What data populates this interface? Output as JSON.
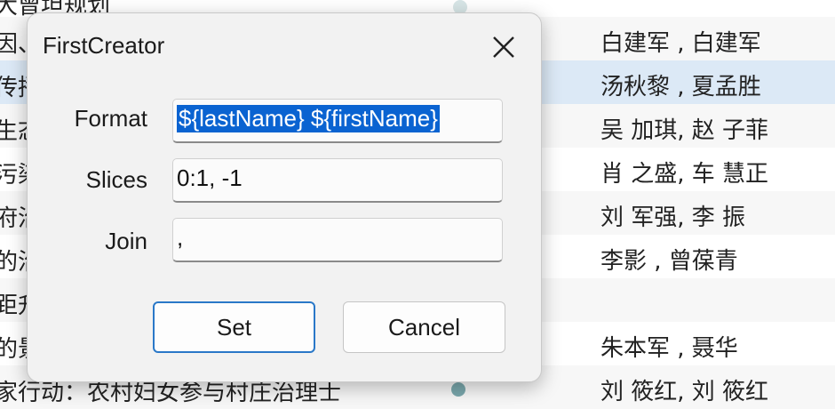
{
  "background_list": {
    "rows": [
      {
        "title": "大曾坦规划",
        "creator": "",
        "style": "plain"
      },
      {
        "title": "因、",
        "creator": "白建军 , 白建军",
        "style": "alt"
      },
      {
        "title": "传播",
        "creator": "汤秋黎 , 夏孟胜",
        "style": "sel"
      },
      {
        "title": "生态",
        "creator": "吴 加琪, 赵 子菲",
        "style": "alt"
      },
      {
        "title": "污染",
        "creator": "肖 之盛, 车 慧正",
        "style": "plain"
      },
      {
        "title": "府治",
        "creator": "刘 军强, 李 振",
        "style": "alt"
      },
      {
        "title": "的治",
        "creator": "李影 , 曾葆青",
        "style": "plain"
      },
      {
        "title": "距升",
        "creator": "",
        "style": "alt"
      },
      {
        "title": "的景",
        "creator": "朱本军 , 聂华",
        "style": "plain"
      },
      {
        "title": "家行动：农村妇女参与村庄治理士",
        "creator": "刘 筱红, 刘 筱红",
        "style": "alt"
      }
    ]
  },
  "dialog": {
    "title": "FirstCreator",
    "format_label": "Format",
    "format_value": "${lastName} ${firstName}",
    "slices_label": "Slices",
    "slices_value": "0:1, -1",
    "join_label": "Join",
    "join_value": ",",
    "set_label": "Set",
    "cancel_label": "Cancel"
  },
  "colors": {
    "selection": "#0a63d1",
    "primary_border": "#2a78c8",
    "selected_row": "#dce9f6",
    "dot": "#7aa8ad"
  }
}
